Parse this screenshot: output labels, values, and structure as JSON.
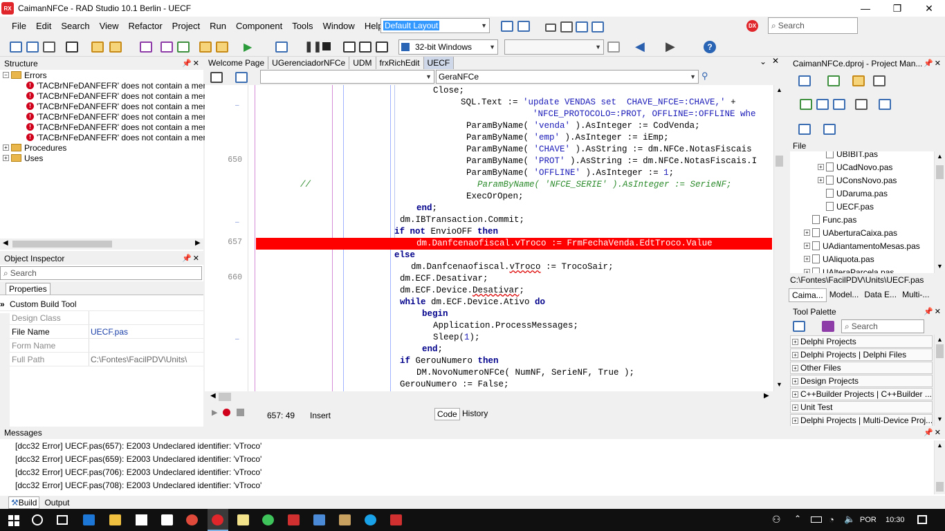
{
  "window": {
    "title": "CaimanNFCe - RAD Studio 10.1 Berlin - UECF",
    "logo": "RX",
    "minimize": "—",
    "restore": "❐",
    "close": "✕"
  },
  "menu": [
    "File",
    "Edit",
    "Search",
    "View",
    "Refactor",
    "Project",
    "Run",
    "Component",
    "Tools",
    "Window",
    "Help"
  ],
  "toolbar": {
    "layout_combo": "Default Layout",
    "platform_combo": "32-bit Windows",
    "search_placeholder": "Search",
    "dx_badge": "DX"
  },
  "structure": {
    "title": "Structure",
    "errors_label": "Errors",
    "errors": [
      "'TACBrNFeDANFEFR' does not contain a men",
      "'TACBrNFeDANFEFR' does not contain a men",
      "'TACBrNFeDANFEFR' does not contain a men",
      "'TACBrNFeDANFEFR' does not contain a men",
      "'TACBrNFeDANFEFR' does not contain a men",
      "'TACBrNFeDANFEFR' does not contain a men"
    ],
    "procedures_label": "Procedures",
    "uses_label": "Uses"
  },
  "object_inspector": {
    "title": "Object Inspector",
    "search_placeholder": "Search",
    "tab": "Properties",
    "section": "Custom Build Tool",
    "properties": [
      {
        "name": "Design Class",
        "value": ""
      },
      {
        "name": "File Name",
        "value": "UECF.pas"
      },
      {
        "name": "Form Name",
        "value": ""
      },
      {
        "name": "Full Path",
        "value": "C:\\Fontes\\FacilPDV\\Units\\"
      }
    ]
  },
  "editor": {
    "tabs": [
      "Welcome Page",
      "UGerenciadorNFCe",
      "UDM",
      "frxRichEdit",
      "UECF"
    ],
    "active_tab": "UECF",
    "method_combo": "GeraNFCe",
    "status_position": "657:  49",
    "status_mode": "Insert",
    "bottom_tabs": [
      "Code",
      "History"
    ],
    "line_numbers": {
      "650": "650",
      "657": "657",
      "660": "660"
    }
  },
  "project_manager": {
    "title": "CaimanNFCe.dproj - Project Man...",
    "file_label": "File",
    "items": [
      {
        "label": "UBIBIT.pas",
        "indent": 2,
        "expander": false
      },
      {
        "label": "UCadNovo.pas",
        "indent": 2,
        "expander": true
      },
      {
        "label": "UConsNovo.pas",
        "indent": 2,
        "expander": true
      },
      {
        "label": "UDaruma.pas",
        "indent": 2,
        "expander": false
      },
      {
        "label": "UECF.pas",
        "indent": 2,
        "expander": false
      },
      {
        "label": "Func.pas",
        "indent": 1,
        "expander": false
      },
      {
        "label": "UAberturaCaixa.pas",
        "indent": 1,
        "expander": true
      },
      {
        "label": "UAdiantamentoMesas.pas",
        "indent": 1,
        "expander": true
      },
      {
        "label": "UAliquota.pas",
        "indent": 1,
        "expander": true
      },
      {
        "label": "UAlteraParcela.pas",
        "indent": 1,
        "expander": true
      }
    ],
    "path": "C:\\Fontes\\FacilPDV\\Units\\UECF.pas",
    "tabs": [
      "Caima...",
      "Model...",
      "Data E...",
      "Multi-..."
    ]
  },
  "tool_palette": {
    "title": "Tool Palette",
    "search_placeholder": "Search",
    "categories": [
      "Delphi Projects",
      "Delphi Projects | Delphi Files",
      "Other Files",
      "Design Projects",
      "C++Builder Projects | C++Builder ...",
      "Unit Test",
      "Delphi Projects | Multi-Device Proj..."
    ]
  },
  "messages": {
    "title": "Messages",
    "rows": [
      "[dcc32 Error] UECF.pas(657): E2003 Undeclared identifier: 'vTroco'",
      "[dcc32 Error] UECF.pas(659): E2003 Undeclared identifier: 'vTroco'",
      "[dcc32 Error] UECF.pas(706): E2003 Undeclared identifier: 'vTroco'",
      "[dcc32 Error] UECF.pas(708): E2003 Undeclared identifier: 'vTroco'"
    ],
    "tabs": [
      "Build",
      "Output"
    ]
  },
  "taskbar": {
    "language": "POR",
    "time": "10:30"
  },
  "colors": {
    "error_line": "#ff0000",
    "keyword": "#00008b",
    "string": "#1a1ab8",
    "comment": "#2a8a2a",
    "active_tab": "#cfd8e8",
    "taskbar": "#101010"
  }
}
